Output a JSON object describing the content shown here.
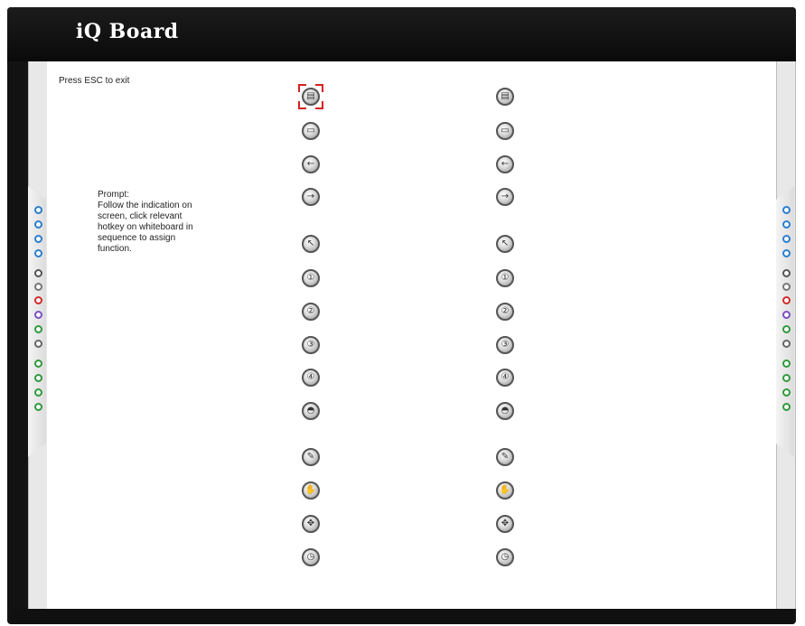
{
  "brand": {
    "logo_text": "iQ Board"
  },
  "screen": {
    "esc_hint": "Press ESC to exit",
    "prompt_lines": [
      "Prompt:",
      "Follow the indication on",
      "screen, click relevant",
      "hotkey on whiteboard in",
      "sequence to assign",
      "function."
    ]
  },
  "hotkeys": [
    {
      "id": "new-page",
      "glyph": "▤",
      "name": "new-page-hotkey-icon"
    },
    {
      "id": "save",
      "glyph": "▭",
      "name": "save-hotkey-icon"
    },
    {
      "id": "previous",
      "glyph": "←",
      "name": "previous-hotkey-icon"
    },
    {
      "id": "next",
      "glyph": "→",
      "name": "next-hotkey-icon"
    },
    {
      "id": "select",
      "glyph": "↖",
      "name": "select-hotkey-icon"
    },
    {
      "id": "custom-1",
      "glyph": "①",
      "name": "custom-1-hotkey-icon"
    },
    {
      "id": "custom-2",
      "glyph": "②",
      "name": "custom-2-hotkey-icon"
    },
    {
      "id": "custom-3",
      "glyph": "③",
      "name": "custom-3-hotkey-icon"
    },
    {
      "id": "custom-4",
      "glyph": "④",
      "name": "custom-4-hotkey-icon"
    },
    {
      "id": "eraser",
      "glyph": "◓",
      "name": "eraser-hotkey-icon"
    },
    {
      "id": "pen",
      "glyph": "✎",
      "name": "pen-hotkey-icon"
    },
    {
      "id": "hand",
      "glyph": "✋",
      "name": "hand-hotkey-icon"
    },
    {
      "id": "move",
      "glyph": "✥",
      "name": "move-hotkey-icon"
    },
    {
      "id": "clock",
      "glyph": "◷",
      "name": "clock-hotkey-icon"
    }
  ],
  "selected_hotkey": "new-page",
  "side_icons": [
    {
      "name": "globe-side-icon",
      "color": "#2a7fd0"
    },
    {
      "name": "info-side-icon",
      "color": "#2a7fd0"
    },
    {
      "name": "keyboard-side-icon",
      "color": "#2a7fd0"
    },
    {
      "name": "printer-side-icon",
      "color": "#2a7fd0"
    },
    {
      "name": "pen-tool-side-icon",
      "color": "#555555"
    },
    {
      "name": "brush-side-icon",
      "color": "#777777"
    },
    {
      "name": "highlighter-side-icon",
      "color": "#d22c2c"
    },
    {
      "name": "color-side-icon",
      "color": "#7a4fc2"
    },
    {
      "name": "eraser-side-icon",
      "color": "#2f9a3c"
    },
    {
      "name": "undo-side-icon",
      "color": "#666666"
    },
    {
      "name": "zoom-side-icon",
      "color": "#2f9a3c"
    },
    {
      "name": "capture-side-icon",
      "color": "#2f9a3c"
    },
    {
      "name": "record-side-icon",
      "color": "#2f9a3c"
    },
    {
      "name": "power-side-icon",
      "color": "#2f9a3c"
    }
  ],
  "colors": {
    "frame": "#121212",
    "selection": "#d62020",
    "screen": "#ffffff"
  }
}
